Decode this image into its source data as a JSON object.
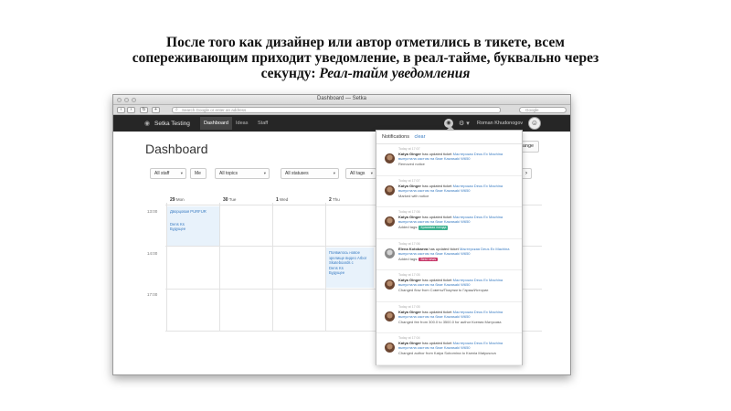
{
  "slide": {
    "title_line1": "После того как дизайнер или автор отметились в тикете, всем",
    "title_line2": "сопереживающим приходит уведомление, в реал-тайме, буквально через",
    "title_line3a": "секунду: ",
    "title_line3b": "Реал-тайм уведомления"
  },
  "browser": {
    "window_title": "Dashboard — Setka",
    "address_placeholder": "Search Google or enter an address",
    "search_placeholder": "Google",
    "back": "‹",
    "forward": "›",
    "reload": "↻",
    "add": "+"
  },
  "app_nav": {
    "brand": "Setka Testing",
    "items": [
      "Dashboard",
      "Ideas",
      "Staff"
    ],
    "user": "Roman Khudonogov",
    "bell": "◉",
    "gear": "⚙ ▾"
  },
  "page": {
    "title": "Dashboard",
    "range_button": "Range",
    "filters": [
      {
        "label": "All staff",
        "caret": "▾"
      },
      {
        "label": "Me",
        "caret": ""
      },
      {
        "label": "All topics",
        "caret": "▾"
      },
      {
        "label": "All statuses",
        "caret": "▾"
      },
      {
        "label": "All tags",
        "caret": "▾"
      }
    ],
    "next": "›"
  },
  "calendar": {
    "days": [
      {
        "num": "29",
        "name": "Mon"
      },
      {
        "num": "30",
        "name": "Tue"
      },
      {
        "num": "1",
        "name": "Wed"
      },
      {
        "num": "2",
        "name": "Thu"
      }
    ],
    "times": [
      "13:00",
      "14:00",
      "17:00"
    ],
    "events": [
      {
        "title": "Дворцовая PURFUR",
        "people": "Dens Ks",
        "status": "Будущее"
      },
      {
        "title": "Появилось новое зрелище видео Arbor Skateboards с",
        "people": "Dens Ks",
        "status": "Будущее"
      }
    ]
  },
  "notifications": {
    "title": "Notifications",
    "clear": "clear",
    "items": [
      {
        "time": "Today at 17:07",
        "user": "Katya Ginger",
        "verb": "has updated ticket",
        "ticket": "Мастерская Deus Ex Machina выпустила кастом на базе Kawasaki W650",
        "action": "Removed notice",
        "tag": "",
        "tag_color": ""
      },
      {
        "time": "Today at 17:07",
        "user": "Katya Ginger",
        "verb": "has updated ticket",
        "ticket": "Мастерская Deus Ex Machina выпустила кастом на базе Kawasaki W650",
        "action": "Marked with notice",
        "tag": "",
        "tag_color": ""
      },
      {
        "time": "Today at 17:06",
        "user": "Katya Ginger",
        "verb": "has updated ticket",
        "ticket": "Мастерская Deus Ex Machina выпустила кастом на базе Kawasaki W650",
        "action": "Added tags:",
        "tag": "Красивая погода",
        "tag_color": "green"
      },
      {
        "time": "Today at 17:06",
        "user": "Elena Kotobaeva",
        "verb": "has updated ticket",
        "ticket": "Мастерская Deus Ex Machina выпустила кастом на базе Kawasaki W650",
        "action": "Added tags:",
        "tag": "Best news",
        "tag_color": "pink"
      },
      {
        "time": "Today at 17:05",
        "user": "Katya Ginger",
        "verb": "has updated ticket",
        "ticket": "Мастерская Deus Ex Machina выпустила кастом на базе Kawasaki W650",
        "action": "Changed flow from Советы/Покупки to Гараж/Истории",
        "tag": "",
        "tag_color": ""
      },
      {
        "time": "Today at 17:05",
        "user": "Katya Ginger",
        "verb": "has updated ticket",
        "ticket": "Мастерская Deus Ex Machina выпустила кастом на базе Kawasaki W650",
        "action": "Changed fee from 300.0 to 3500.0 for author Ксения Матусова",
        "tag": "",
        "tag_color": ""
      },
      {
        "time": "Today at 17:04",
        "user": "Katya Ginger",
        "verb": "has updated ticket",
        "ticket": "Мастерская Deus Ex Machina выпустила кастом на базе Kawasaki W650",
        "action": "Changed author from Katya Sobornina to Ksenia Matyusova",
        "tag": "",
        "tag_color": ""
      }
    ]
  }
}
